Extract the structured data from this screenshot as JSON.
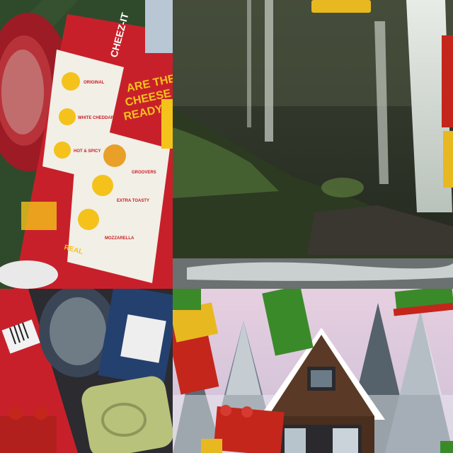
{
  "tiles": {
    "top_left": {
      "brand": "CHEEZ-IT",
      "headline_1": "ARE THEY",
      "headline_2": "CHEESE",
      "headline_3": "READY?",
      "flavor_1": "ORIGINAL",
      "flavor_2": "WHITE CHEDDAR",
      "flavor_3": "HOT & SPICY",
      "flavor_4": "GROOVERS",
      "flavor_5": "EXTRA TOASTY",
      "flavor_6": "MOZZARELLA",
      "badge": "REAL"
    }
  },
  "colors": {
    "box_red": "#c8202a",
    "box_yellow": "#f4c21a",
    "bowl_red": "#9c1b24",
    "felt_green": "#2f4a2a",
    "lego_green": "#3b8a2a",
    "lego_red": "#c4261c",
    "lego_yellow": "#e8b820",
    "sky_pink": "#d9c6dc",
    "cabin_brown": "#5a3a26"
  }
}
